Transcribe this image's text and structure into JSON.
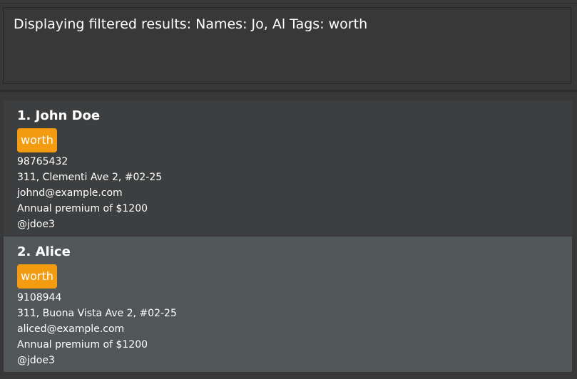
{
  "result_display": {
    "text": "Displaying filtered results: Names: Jo, Al Tags: worth"
  },
  "persons": [
    {
      "index_name": "1. John Doe",
      "tag": "worth",
      "phone": "98765432",
      "address": "311, Clementi Ave 2, #02-25",
      "email": "johnd@example.com",
      "premium": "Annual premium of $1200",
      "handle": "@jdoe3"
    },
    {
      "index_name": "2. Alice",
      "tag": "worth",
      "phone": "9108944",
      "address": "311, Buona Vista Ave 2, #02-25",
      "email": "aliced@example.com",
      "premium": "Annual premium of $1200",
      "handle": "@jdoe3"
    }
  ],
  "colors": {
    "background": "#383838",
    "card_odd": "#3c3e3f",
    "card_even": "#515658",
    "tag": "#f39c12",
    "text": "#ffffff"
  }
}
